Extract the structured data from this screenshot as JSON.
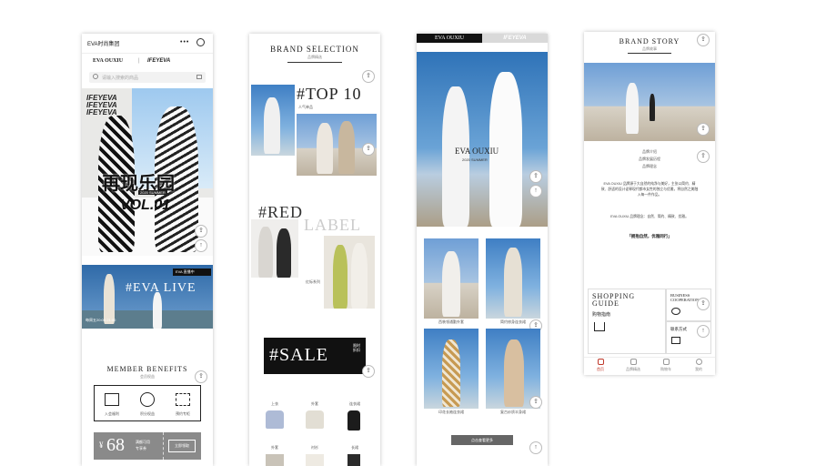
{
  "screen1": {
    "status_title": "EVA时尚集团",
    "brand_left": "EVA OUXIU",
    "brand_right": "IFEYEVA",
    "search_placeholder": "请输入搜索的商品",
    "hero_brand_lines": [
      "IFEYEVA",
      "IFEYEVA",
      "IFEYEVA"
    ],
    "hero_title": "再现乐园",
    "hero_sub": "2020 SUMMER",
    "hero_vol": "VOL.01",
    "live_tag": "EVA 直播中",
    "live_title": "#EVA LIVE",
    "live_time": "每周五20:00-21:00",
    "member_title": "MEMBER BENEFITS",
    "member_sub": "会员权益",
    "benefits": [
      {
        "icon": "gift-icon",
        "label": "入会福利"
      },
      {
        "icon": "coins-icon",
        "label": "积分权益"
      },
      {
        "icon": "calendar-icon",
        "label": "预约专柜"
      }
    ],
    "coupon_value": "68",
    "coupon_currency": "¥",
    "coupon_desc_1": "满额可用",
    "coupon_desc_2": "专享券",
    "coupon_btn": "立即领取"
  },
  "screen2": {
    "title": "BRAND SELECTION",
    "subtitle": "品牌精选",
    "top_title": "#TOP 10",
    "top_sub": "人气单品",
    "red_title_1": "#RED",
    "red_title_2": "LABEL",
    "red_sub": "红标系列",
    "sale_title": "#SALE",
    "sale_side": "限时折扣",
    "products_row1": [
      "上衣",
      "外套",
      "连衣裙"
    ],
    "products_row2": [
      "外套",
      "衬衫",
      "长裙"
    ]
  },
  "screen3": {
    "tab_active": "EVA OUXIU",
    "tab_inactive": "IFEYEVA",
    "hero_brand": "EVA OUXIU",
    "hero_sub": "2020 SUMMER",
    "captions": [
      "西装领通勤外套",
      "简约修身连衣裙",
      "印花长袖连衣裙",
      "复古纱质半身裙"
    ],
    "more_button": "点击查看更多"
  },
  "screen4": {
    "title": "BRAND STORY",
    "subtitle": "品牌故事",
    "list": [
      "品牌介绍",
      "品牌发展历程",
      "品牌理念"
    ],
    "para1": "EVA OUXIU 品牌源于大自然的纯净与美好，主张以简约、精致、舒适的设计诠释现代都市女性的独立与优雅，将自然之美融入每一件作品。",
    "para2": "EVA OUXIU 品牌理念：自然、简约、精致、优雅。",
    "quote": "「拥抱自然，优雅同行」",
    "guide_title_1": "SHOPPING",
    "guide_title_2": "GUIDE",
    "guide_cn": "购物指南",
    "business_1": "BUSINESS",
    "business_2": "COOPERATION",
    "contact": "联系方式",
    "nav": [
      "首页",
      "品牌精选",
      "购物车",
      "我的"
    ]
  }
}
